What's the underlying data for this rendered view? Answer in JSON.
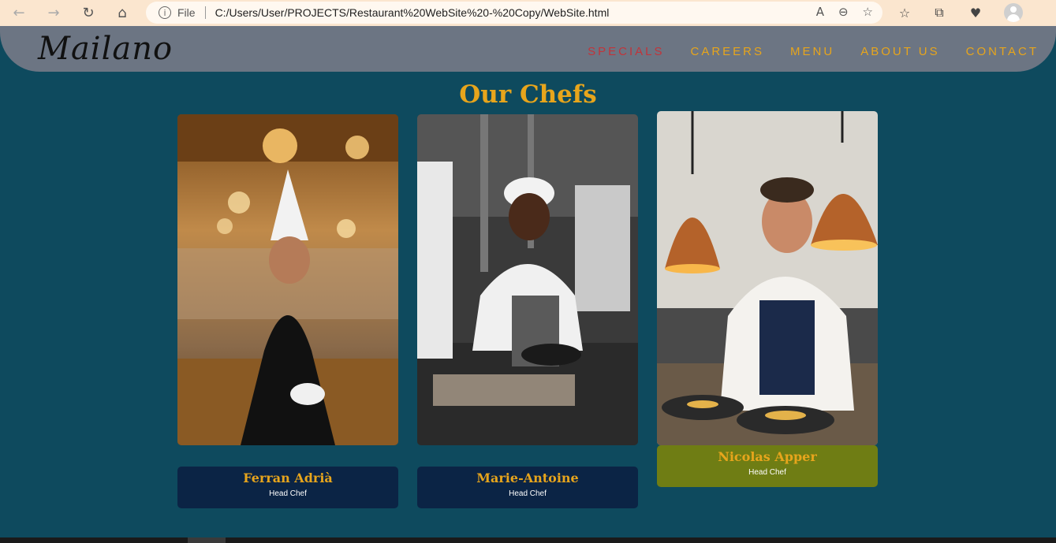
{
  "browser": {
    "address_file_label": "File",
    "url": "C:/Users/User/PROJECTS/Restaurant%20WebSite%20-%20Copy/WebSite.html"
  },
  "site": {
    "logo": "Mailano",
    "nav": [
      {
        "label": "SPECIALS",
        "active": true
      },
      {
        "label": "CAREERS",
        "active": false
      },
      {
        "label": "MENU",
        "active": false
      },
      {
        "label": "ABOUT US",
        "active": false
      },
      {
        "label": "CONTACT",
        "active": false
      }
    ]
  },
  "main": {
    "section_title": "Our Chefs",
    "chefs": [
      {
        "name": "Ferran Adrià",
        "role": "Head Chef"
      },
      {
        "name": "Marie-Antoine",
        "role": "Head Chef"
      },
      {
        "name": "Nicolas Apper",
        "role": "Head Chef"
      }
    ]
  },
  "colors": {
    "page_background": "#0e4a5e",
    "accent_gold": "#e7a51c",
    "active_nav": "#c1343a",
    "header_bar": "#6c7583",
    "card_label": "#0b2445",
    "card_label_hover": "#6f7d14"
  }
}
